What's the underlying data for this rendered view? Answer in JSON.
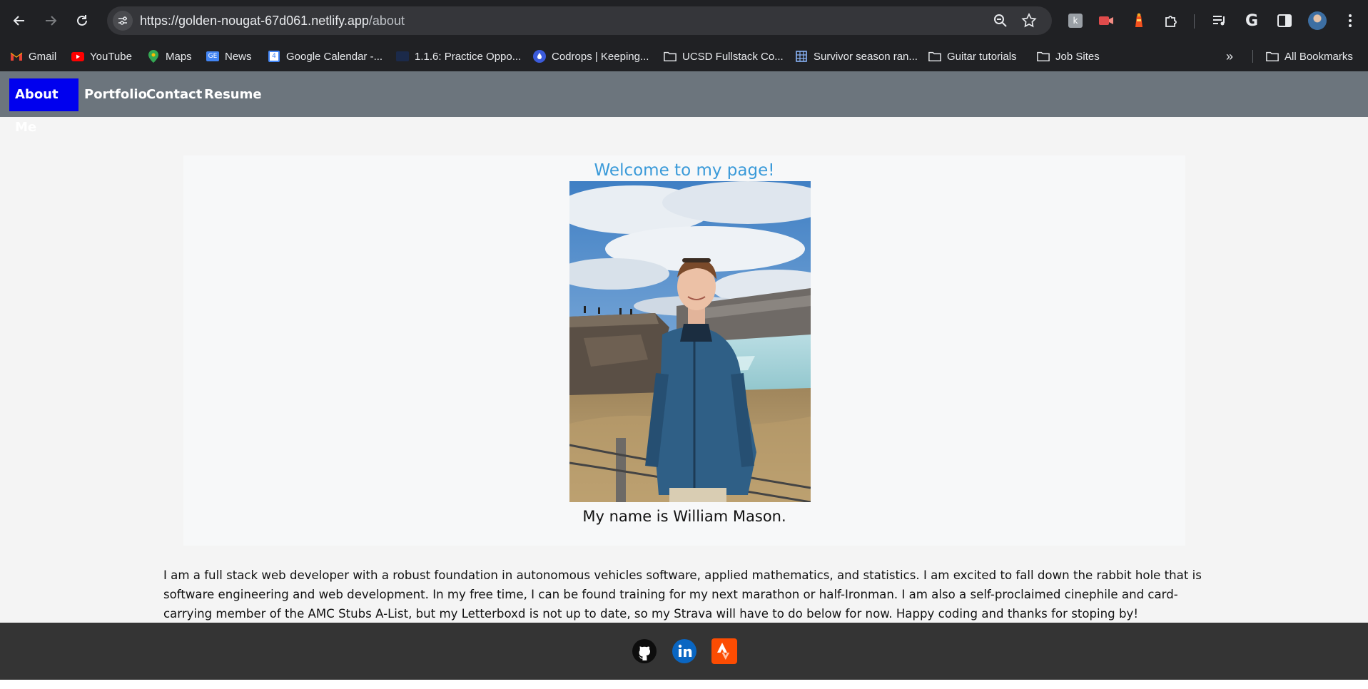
{
  "browser": {
    "url_host": "https://golden-nougat-67d061.netlify.app",
    "url_path": "/about",
    "bookmarks": [
      {
        "label": "Gmail",
        "icon": "gmail-icon"
      },
      {
        "label": "YouTube",
        "icon": "youtube-icon"
      },
      {
        "label": "Maps",
        "icon": "maps-icon"
      },
      {
        "label": "News",
        "icon": "news-icon"
      },
      {
        "label": "Google Calendar -...",
        "icon": "calendar-icon"
      },
      {
        "label": "1.1.6: Practice Oppo...",
        "icon": "course-icon"
      },
      {
        "label": "Codrops | Keeping...",
        "icon": "codrops-icon"
      },
      {
        "label": "UCSD Fullstack Co...",
        "icon": "folder-icon"
      },
      {
        "label": "Survivor season ran...",
        "icon": "sheet-icon"
      },
      {
        "label": "Guitar tutorials",
        "icon": "folder-icon"
      },
      {
        "label": "Job Sites",
        "icon": "folder-icon"
      }
    ],
    "all_bookmarks": "All Bookmarks"
  },
  "site_nav": {
    "about": "About Me",
    "portfolio": "Portfolio",
    "contact": "Contact",
    "resume": "Resume",
    "active": "about"
  },
  "hero": {
    "welcome": "Welcome to my page!",
    "name_line": "My name is William Mason."
  },
  "bio": "I am a full stack web developer with a robust foundation in autonomous vehicles software, applied mathematics, and statistics. I am excited to fall down the rabbit hole that is software engineering and web development. In my free time, I can be found training for my next marathon or half-Ironman. I am also a self-proclaimed cinephile and card-carrying member of the AMC Stubs A-List, but my Letterboxd is not up to date, so my Strava will have to do below for now. Happy coding and thanks for stoping by!",
  "footer": {
    "icons": [
      "github-icon",
      "linkedin-icon",
      "strava-icon"
    ]
  },
  "colors": {
    "nav_bg": "#6c757d",
    "active_nav": "#0000ee",
    "welcome_text": "#3a9ad9",
    "footer_bg": "#343434"
  }
}
